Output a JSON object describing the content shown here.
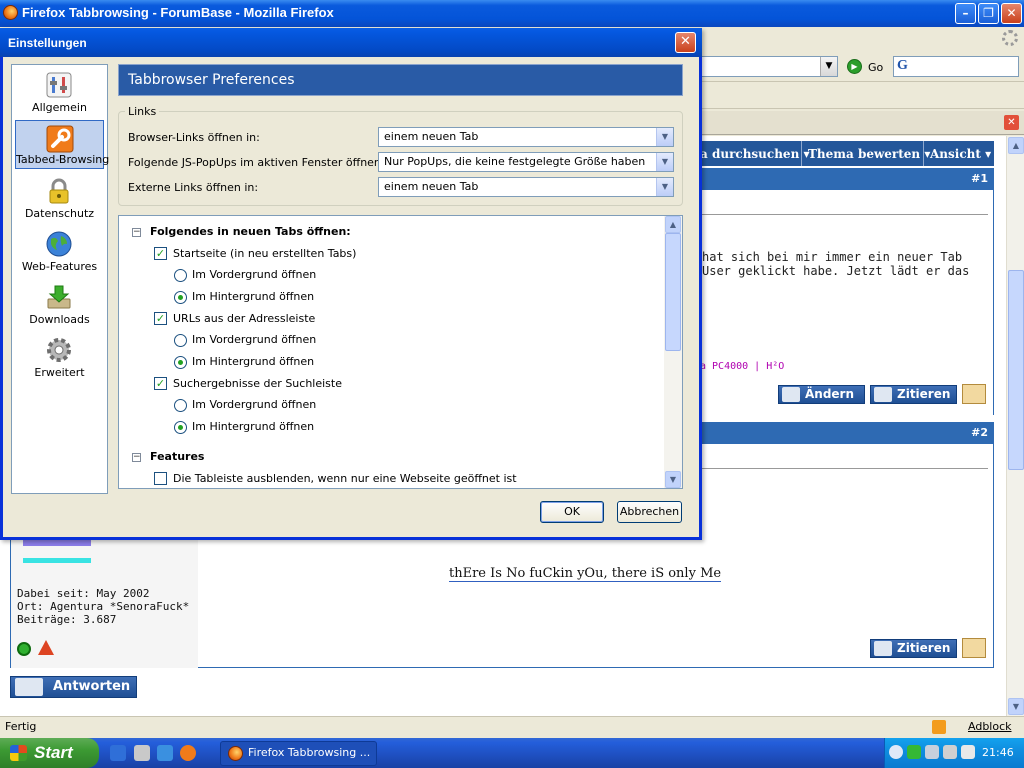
{
  "browser": {
    "title": "Firefox Tabbrowsing - ForumBase - Mozilla Firefox",
    "go_label": "Go",
    "status_text": "Fertig",
    "adblock_label": "Adblock"
  },
  "forum": {
    "toolbar": {
      "search_label": "a durchsuchen ▾",
      "rate_label": "Thema bewerten ▾",
      "view_label": "Ansicht ▾"
    },
    "post1": {
      "number": "#1",
      "text_line1": "hat sich bei mir immer ein neuer Tab",
      "text_line2": "User geklickt habe. Jetzt lädt er das",
      "signature": "a PC4000 | H²O",
      "edit_label": "Ändern",
      "quote_label": "Zitieren"
    },
    "post2": {
      "number": "#2",
      "member_since": "Dabei seit: May 2002",
      "location": "Ort: Agentura *SenoraFuck*",
      "posts": "Beiträge: 3.687",
      "signature": "thEre Is No fuCkin yOu, there iS only Me",
      "quote_label": "Zitieren"
    },
    "reply_label": "Antworten"
  },
  "taskbar": {
    "start_label": "Start",
    "task_label": "Firefox Tabbrowsing ...",
    "clock": "21:46"
  },
  "dialog": {
    "title": "Einstellungen",
    "categories": [
      {
        "label": "Allgemein"
      },
      {
        "label": "Tabbed-Browsing"
      },
      {
        "label": "Datenschutz"
      },
      {
        "label": "Web-Features"
      },
      {
        "label": "Downloads"
      },
      {
        "label": "Erweitert"
      }
    ],
    "pane_title": "Tabbrowser Preferences",
    "links_group": {
      "legend": "Links",
      "rows": [
        {
          "label": "Browser-Links öffnen in:",
          "value": "einem neuen Tab"
        },
        {
          "label": "Folgende JS-PopUps im aktiven Fenster öffnen:",
          "value": "Nur PopUps, die keine festgelegte Größe haben"
        },
        {
          "label": "Externe Links öffnen in:",
          "value": "einem neuen Tab"
        }
      ]
    },
    "tree": {
      "group1_label": "Folgendes in neuen Tabs öffnen:",
      "items": [
        {
          "label": "Startseite (in neu erstellten Tabs)",
          "checked": true,
          "fg": "Im Vordergrund öffnen",
          "bg": "Im Hintergrund öffnen"
        },
        {
          "label": "URLs aus der Adressleiste",
          "checked": true,
          "fg": "Im Vordergrund öffnen",
          "bg": "Im Hintergrund öffnen"
        },
        {
          "label": "Suchergebnisse der Suchleiste",
          "checked": true,
          "fg": "Im Vordergrund öffnen",
          "bg": "Im Hintergrund öffnen"
        }
      ],
      "group2_label": "Features",
      "feature1_label": "Die Tableiste ausblenden, wenn nur eine Webseite geöffnet ist"
    },
    "ok_label": "OK",
    "cancel_label": "Abbrechen"
  },
  "colors": {
    "xp_blue": "#0454D8",
    "forum_header": "#2E6AB3",
    "pane_header": "#295BA6",
    "selection": "#C1D2EE",
    "check_green": "#21A121",
    "signature_magenta": "#B000B0"
  },
  "icons": {
    "firefox": "firefox-logo-icon",
    "close": "close-icon",
    "go": "go-arrow-icon",
    "rss": "rss-icon"
  }
}
